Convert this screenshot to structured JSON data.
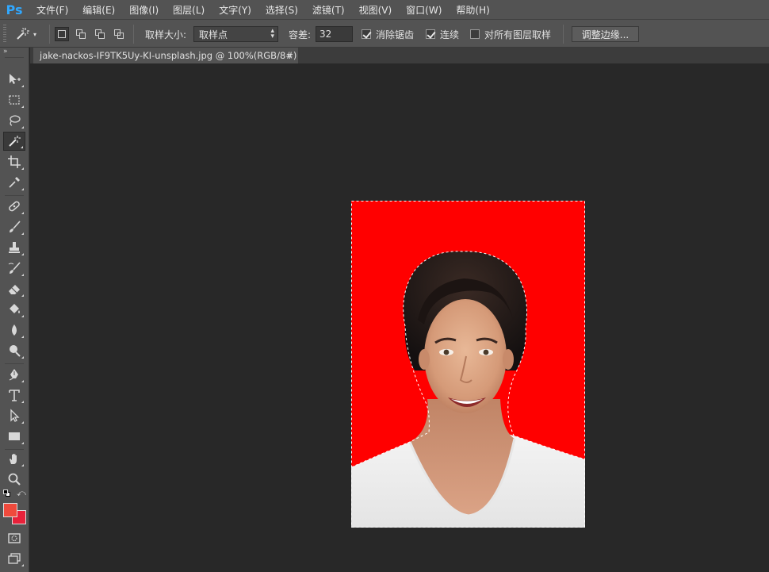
{
  "app": {
    "logo": "Ps",
    "menu": [
      "文件(F)",
      "编辑(E)",
      "图像(I)",
      "图层(L)",
      "文字(Y)",
      "选择(S)",
      "滤镜(T)",
      "视图(V)",
      "窗口(W)",
      "帮助(H)"
    ]
  },
  "options": {
    "sample_size_label": "取样大小:",
    "sample_size_value": "取样点",
    "tolerance_label": "容差:",
    "tolerance_value": "32",
    "anti_alias_label": "消除锯齿",
    "anti_alias_checked": true,
    "contiguous_label": "连续",
    "contiguous_checked": true,
    "sample_all_layers_label": "对所有图层取样",
    "sample_all_layers_checked": false,
    "refine_edge_label": "调整边缘..."
  },
  "document": {
    "tab_title": "jake-nackos-IF9TK5Uy-KI-unsplash.jpg @ 100%(RGB/8#)",
    "close_glyph": "×"
  },
  "colors": {
    "foreground": "#f04a3c",
    "background": "#e8213a",
    "photo_background": "#ff0000",
    "app_bg": "#282828",
    "panel_bg": "#535353"
  },
  "tools": [
    "move-tool",
    "marquee-tool",
    "lasso-tool",
    "magic-wand-tool",
    "crop-tool",
    "eyedropper-tool",
    "healing-brush-tool",
    "brush-tool",
    "clone-stamp-tool",
    "history-brush-tool",
    "eraser-tool",
    "paint-bucket-tool",
    "blur-tool",
    "dodge-tool",
    "pen-tool",
    "type-tool",
    "path-selection-tool",
    "rectangle-tool",
    "hand-tool",
    "zoom-tool"
  ]
}
